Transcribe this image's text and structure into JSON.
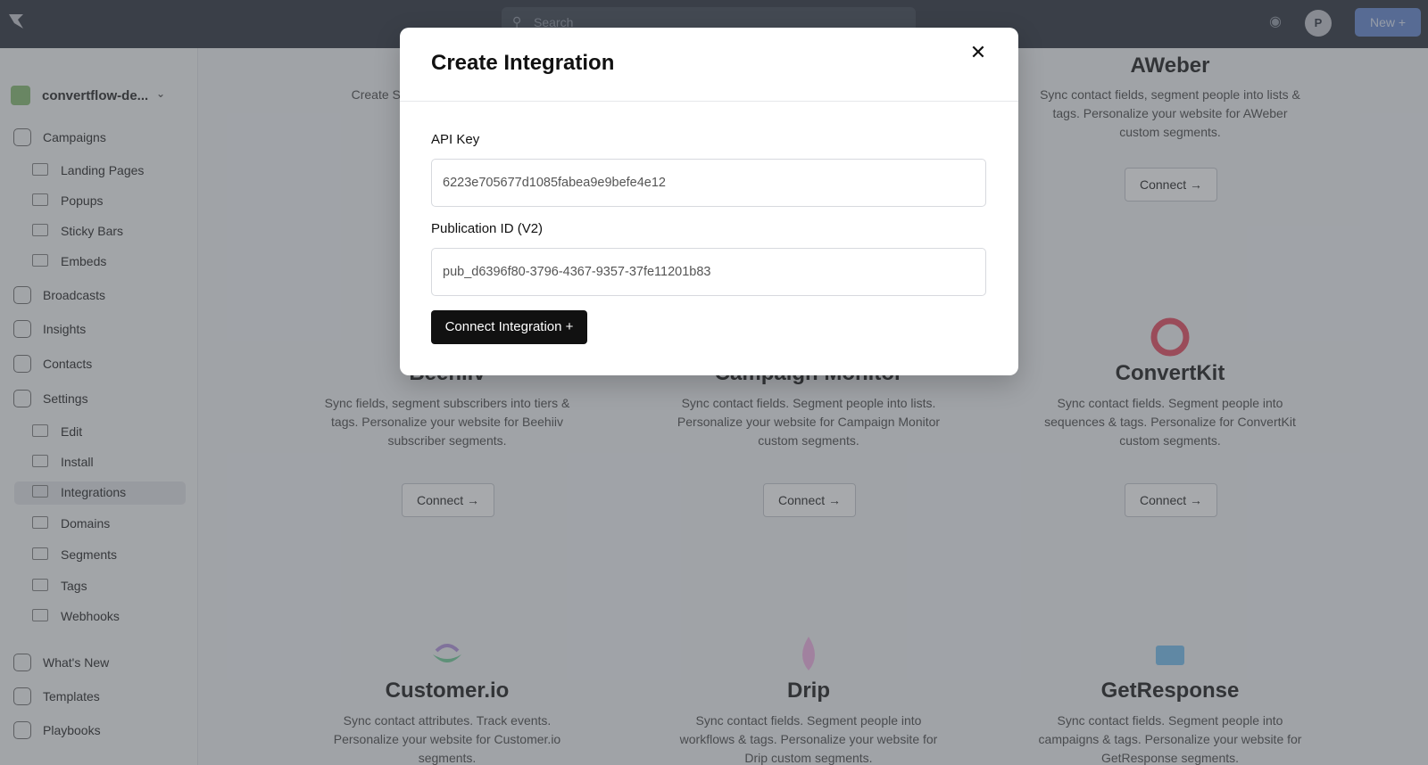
{
  "topbar": {
    "search_placeholder": "Search",
    "avatar_initial": "P",
    "new_label": "New"
  },
  "sidebar": {
    "workspace": "convertflow-de...",
    "items": [
      {
        "label": "Campaigns"
      },
      {
        "label": "Landing Pages"
      },
      {
        "label": "Popups"
      },
      {
        "label": "Sticky Bars"
      },
      {
        "label": "Embeds"
      },
      {
        "label": "Broadcasts"
      },
      {
        "label": "Insights"
      },
      {
        "label": "Contacts"
      },
      {
        "label": "Settings"
      },
      {
        "label": "Edit"
      },
      {
        "label": "Install"
      },
      {
        "label": "Integrations"
      },
      {
        "label": "Domains"
      },
      {
        "label": "Segments"
      },
      {
        "label": "Tags"
      },
      {
        "label": "Webhooks"
      },
      {
        "label": "What's New"
      },
      {
        "label": "Templates"
      },
      {
        "label": "Playbooks"
      }
    ]
  },
  "cards": [
    {
      "name": "",
      "desc": "Create SMS ... campaigns ... for ...",
      "button": ""
    },
    {
      "name": "AWeber",
      "desc": "Sync contact fields, segment people into lists & tags. Personalize your website for AWeber custom segments.",
      "button": "Connect →"
    },
    {
      "name": "Beehiiv",
      "desc": "Sync fields, segment subscribers into tiers & tags. Personalize your website for Beehiiv subscriber segments.",
      "button": "Connect →"
    },
    {
      "name": "Campaign Monitor",
      "desc": "Sync contact fields. Segment people into lists. Personalize your website for Campaign Monitor custom segments.",
      "button": "Connect →"
    },
    {
      "name": "ConvertKit",
      "desc": "Sync contact fields. Segment people into sequences & tags. Personalize for ConvertKit custom segments.",
      "button": "Connect →"
    },
    {
      "name": "Customer.io",
      "desc": "Sync contact attributes. Track events. Personalize your website for Customer.io segments.",
      "button": ""
    },
    {
      "name": "Drip",
      "desc": "Sync contact fields. Segment people into workflows & tags. Personalize your website for Drip custom segments.",
      "button": ""
    },
    {
      "name": "GetResponse",
      "desc": "Sync contact fields. Segment people into campaigns & tags. Personalize your website for GetResponse segments.",
      "button": ""
    }
  ],
  "modal": {
    "title": "Create Integration",
    "close_icon": "close-icon",
    "api_key_label": "API Key",
    "api_key_value": "6223e705677d1085fabea9e9befe4e12",
    "publication_label": "Publication ID (V2)",
    "publication_value": "pub_d6396f80-3796-4367-9357-37fe11201b83",
    "connect_label": "Connect Integration +"
  },
  "colors": {
    "topbar": "#3a3f4a",
    "primary_button": "#111111",
    "new_button": "#6d8fd4",
    "overlay": "rgba(60,64,72,0.45)"
  }
}
